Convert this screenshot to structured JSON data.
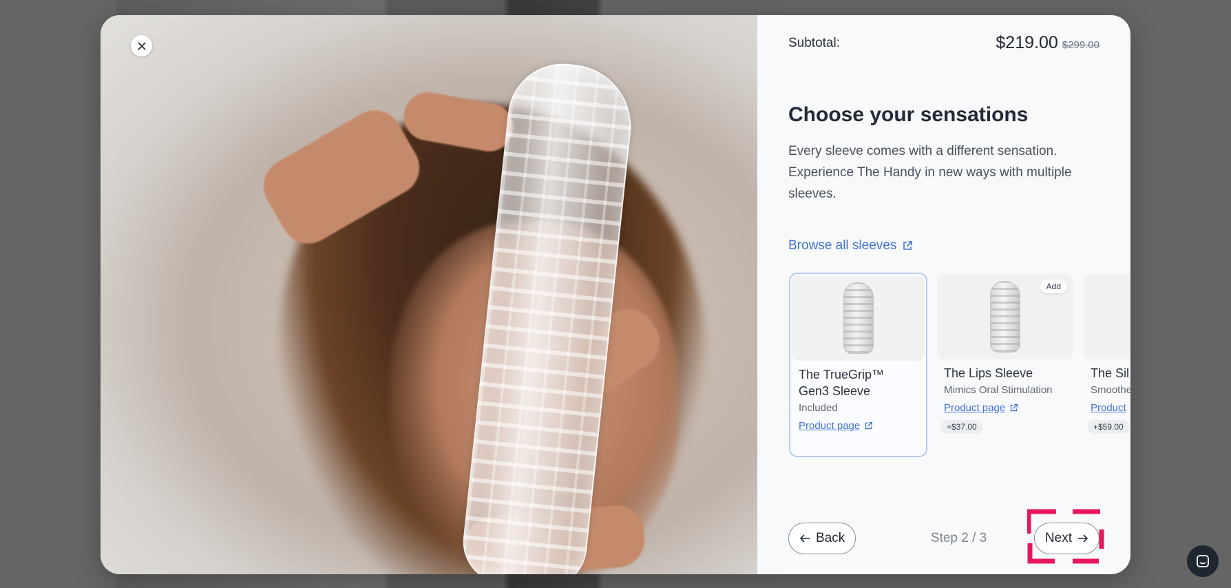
{
  "modal": {
    "close_icon": "close-icon",
    "subtotal_label": "Subtotal:",
    "price_current": "$219.00",
    "price_original": "$299.00",
    "heading": "Choose your sensations",
    "description": "Every sleeve comes with a different sensation. Experience The Handy in new ways with multiple sleeves.",
    "browse_link": "Browse all sleeves",
    "cards": [
      {
        "name": "The TrueGrip™ Gen3 Sleeve",
        "subtitle": "Included",
        "link": "Product page",
        "selected": true
      },
      {
        "name": "The Lips Sleeve",
        "subtitle": "Mimics Oral Stimulation",
        "link": "Product page",
        "price": "+$37.00",
        "badge": "Add"
      },
      {
        "name": "The Sil",
        "subtitle": "Smoothe touch",
        "link": "Product",
        "price": "+$59.00"
      }
    ],
    "footer": {
      "back_label": "Back",
      "step_label": "Step 2 / 3",
      "next_label": "Next"
    }
  },
  "colors": {
    "accent_link": "#3f73d9",
    "selection_border": "#b9c9ef",
    "marker": "#e8175d"
  }
}
